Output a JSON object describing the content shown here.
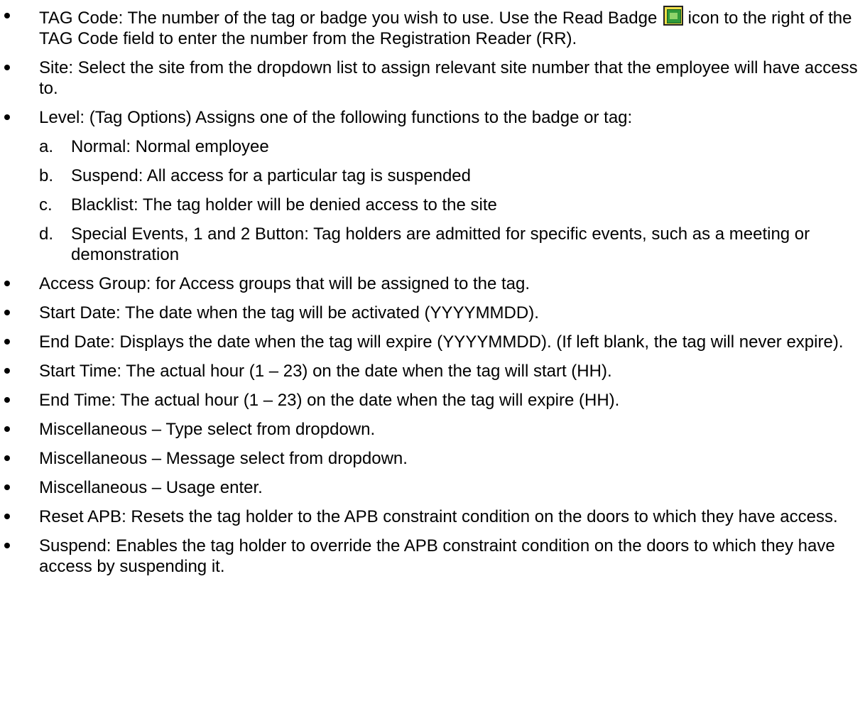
{
  "items": [
    {
      "lead": "TAG Code: The number of the tag or badge you wish to use. Use the Read Badge ",
      "icon": "read-badge-icon",
      "tail": " icon to the right of the TAG Code field to enter the number from the Registration Reader (RR)."
    },
    {
      "text": "Site: Select the site from the dropdown list to assign relevant site number that the employee will have access to."
    },
    {
      "text": "Level: (Tag Options) Assigns one of the following functions to the badge or tag:",
      "sub": [
        {
          "marker": "a.",
          "text": "Normal: Normal employee"
        },
        {
          "marker": "b.",
          "text": "Suspend: All access for a particular tag is suspended"
        },
        {
          "marker": "c.",
          "text": "Blacklist: The tag holder will be denied access to the site"
        },
        {
          "marker": "d.",
          "text": "Special Events, 1 and 2 Button: Tag holders are admitted for specific events, such as a meeting or demonstration"
        }
      ]
    },
    {
      "text": "Access Group: for Access groups that will be assigned to the tag."
    },
    {
      "text": "Start Date: The date when the tag will be activated (YYYYMMDD)."
    },
    {
      "text": "End Date: Displays the date when the tag will expire (YYYYMMDD). (If left blank, the tag will never expire)."
    },
    {
      "text": "Start Time: The actual hour (1 – 23) on the date when the tag will start (HH)."
    },
    {
      "text": "End Time: The actual hour (1 – 23) on the date when the tag will expire (HH)."
    },
    {
      "text": "Miscellaneous – Type select from dropdown."
    },
    {
      "text": "Miscellaneous – Message select from dropdown."
    },
    {
      "text": "Miscellaneous – Usage enter."
    },
    {
      "text": "Reset APB: Resets the tag holder to the APB constraint condition on the doors to which they have access."
    },
    {
      "text": "Suspend: Enables the tag holder to override the APB constraint condition on the doors to which they have access by suspending it."
    }
  ]
}
